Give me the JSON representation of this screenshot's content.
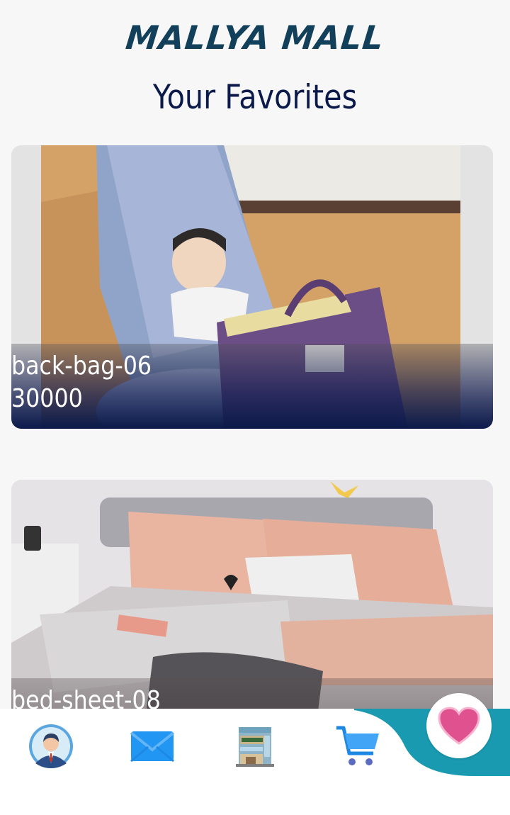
{
  "header": {
    "brand": "MALLYA MALL",
    "title": "Your Favorites"
  },
  "favorites": [
    {
      "name": "back-bag-06",
      "price": "30000"
    },
    {
      "name": "bed-sheet-08",
      "price": ""
    }
  ],
  "bottom_nav": {
    "items": [
      {
        "icon": "profile-avatar-icon"
      },
      {
        "icon": "mail-icon"
      },
      {
        "icon": "mall-building-icon"
      },
      {
        "icon": "cart-icon"
      },
      {
        "icon": "heart-icon",
        "active": true
      }
    ],
    "accent_color": "#1a9ab0"
  }
}
